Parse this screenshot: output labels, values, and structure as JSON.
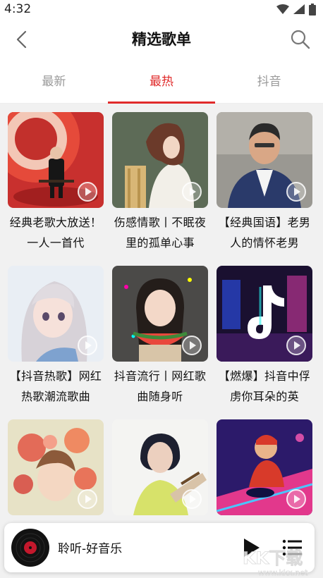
{
  "status": {
    "time": "4:32"
  },
  "nav": {
    "title": "精选歌单"
  },
  "tabs": [
    {
      "label": "最新",
      "active": false
    },
    {
      "label": "最热",
      "active": true
    },
    {
      "label": "抖音",
      "active": false
    }
  ],
  "playlists": [
    {
      "title": "经典老歌大放送！一人一首代",
      "cover": "cover-red-stage-singer"
    },
    {
      "title": "伤感情歌丨不眠夜里的孤单心事",
      "cover": "cover-illustrated-girl"
    },
    {
      "title": "【经典国语】老男人的情怀老男",
      "cover": "cover-man-in-suit"
    },
    {
      "title": "【抖音热歌】网红热歌潮流歌曲",
      "cover": "cover-anime-girl"
    },
    {
      "title": "抖音流行丨网红歌曲随身听",
      "cover": "cover-girl-watermelon"
    },
    {
      "title": "【燃爆】抖音中俘虏你耳朵的英",
      "cover": "cover-tiktok-neon"
    },
    {
      "title": "",
      "cover": "cover-flowers-girl"
    },
    {
      "title": "",
      "cover": "cover-woman-guitar"
    },
    {
      "title": "",
      "cover": "cover-dj-neon"
    }
  ],
  "player": {
    "title": "聆听-好音乐"
  },
  "watermark": {
    "text": "KK下载",
    "url": "www.kkx.net"
  },
  "colors": {
    "accent": "#e02a2a",
    "background": "#f1f1f1"
  }
}
